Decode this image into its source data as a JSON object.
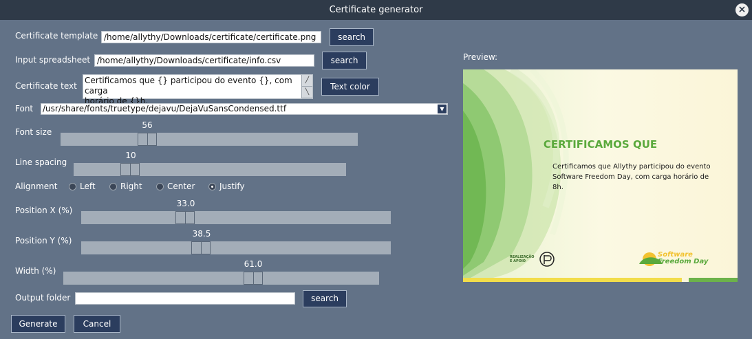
{
  "window": {
    "title": "Certificate generator",
    "close_icon": "×"
  },
  "template": {
    "label": "Certificate template",
    "value": "/home/allythy/Downloads/certificate/certificate.png",
    "button": "search"
  },
  "spreadsheet": {
    "label": "Input spreadsheet",
    "value": "/home/allythy/Downloads/certificate/info.csv",
    "button": "search"
  },
  "cert_text": {
    "label": "Certificate text",
    "line1": "Certificamos que {} participou do evento {}, com carga",
    "line2": "horário de {}h.",
    "button": "Text color"
  },
  "font": {
    "label": "Font",
    "value": "/usr/share/fonts/truetype/dejavu/DejaVuSansCondensed.ttf"
  },
  "font_size": {
    "label": "Font size",
    "value": "56",
    "level": 0.28
  },
  "line_spacing": {
    "label": "Line spacing",
    "value": "10",
    "level": 0.21
  },
  "alignment": {
    "label": "Alignment",
    "options": [
      "Left",
      "Right",
      "Center",
      "Justify"
    ],
    "selected": "Justify"
  },
  "pos_x": {
    "label": "Position X (%)",
    "value": "33.0",
    "level": 0.33
  },
  "pos_y": {
    "label": "Position Y (%)",
    "value": "38.5",
    "level": 0.385
  },
  "width": {
    "label": "Width (%)",
    "value": "61.0",
    "level": 0.61
  },
  "output": {
    "label": "Output folder",
    "value": "",
    "button": "search"
  },
  "preview": {
    "label": "Preview:",
    "heading": "CERTIFICAMOS QUE",
    "body_line1": "Certificamos que Allythy participou do evento",
    "body_line2": "Software Freedom Day, com carga horário de",
    "body_line3": "8h.",
    "sponsor_label_1": "REALIZAÇÃO",
    "sponsor_label_2": "E APOIO",
    "logo_1": "Software",
    "logo_2": "Freedom Day",
    "heading_color": "#5aa93c"
  },
  "actions": {
    "generate": "Generate",
    "cancel": "Cancel"
  }
}
